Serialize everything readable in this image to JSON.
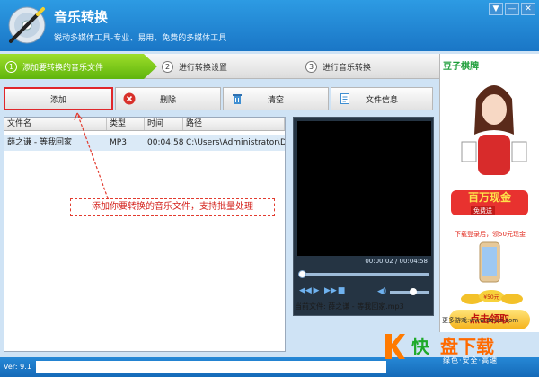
{
  "app": {
    "title": "音乐转换",
    "subtitle": "锐动多媒体工具-专业、易用、免费的多媒体工具"
  },
  "window_buttons": [
    "▼",
    "—",
    "✕"
  ],
  "steps": [
    {
      "num": "1",
      "label": "添加要转换的音乐文件"
    },
    {
      "num": "2",
      "label": "进行转换设置"
    },
    {
      "num": "3",
      "label": "进行音乐转换"
    }
  ],
  "toolbar": {
    "add": "添加",
    "delete": "删除",
    "clear": "清空",
    "file_info": "文件信息"
  },
  "file_list": {
    "columns": [
      "文件名",
      "类型",
      "时间",
      "路径"
    ],
    "rows": [
      {
        "name": "薛之谦 - 等我回家",
        "type": "MP3",
        "time": "00:04:58",
        "path": "C:\\Users\\Administrator\\D..."
      }
    ]
  },
  "annotation": "添加你要转换的音乐文件，支持批量处理",
  "player": {
    "time": "00:00:02 / 00:04:58",
    "seek_fraction": 0.007,
    "volume_fraction": 0.6,
    "current_file": "当前文件: 薛之谦 - 等我回家.mp3"
  },
  "ad": {
    "brand": "豆子棋牌",
    "headline": "百万现金",
    "sub": "免费送",
    "promo": "下载登录后，领50元现金",
    "coin_label": "¥50元",
    "cta": "点击领取",
    "more": "更多游戏:www.douzi.com"
  },
  "status": {
    "version": "Ver: 9.1"
  },
  "watermark": {
    "kuai": "快",
    "brand": "盘下载",
    "slogan": "绿色·安全·高速"
  },
  "colors": {
    "title_blue": "#1a76c6",
    "step_green": "#5fb50e",
    "highlight_red": "#e0272b"
  }
}
